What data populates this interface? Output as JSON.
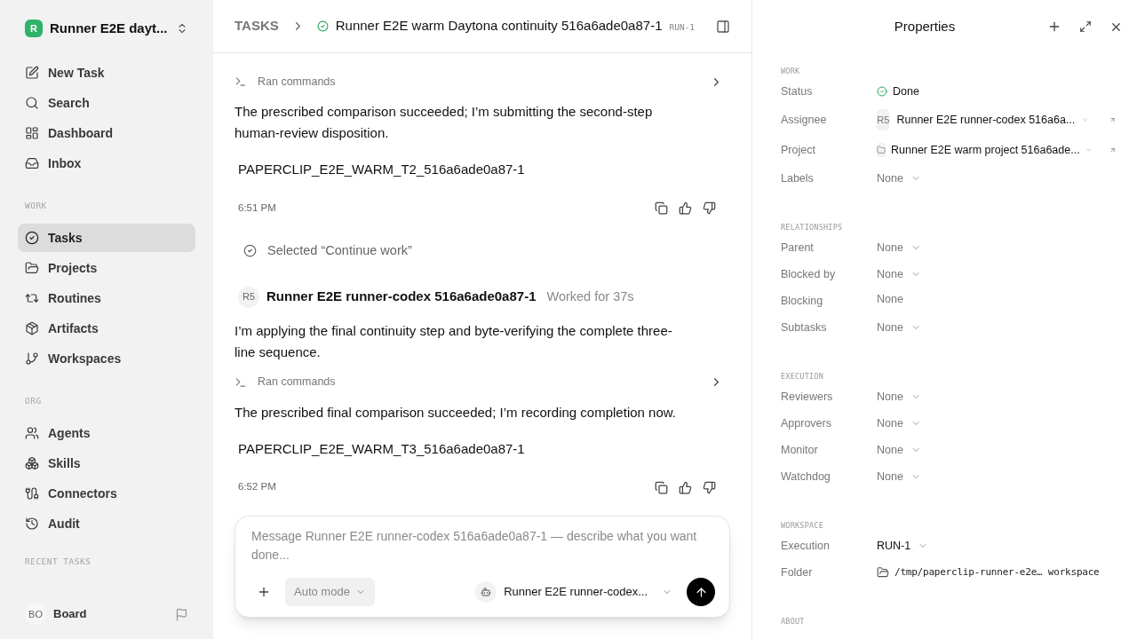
{
  "sidebar": {
    "workspace": {
      "initial": "R",
      "name": "Runner E2E dayt..."
    },
    "top_items": [
      {
        "label": "New Task",
        "selected": false
      },
      {
        "label": "Search",
        "selected": false
      },
      {
        "label": "Dashboard",
        "selected": false
      },
      {
        "label": "Inbox",
        "selected": false
      }
    ],
    "sections": [
      {
        "title": "WORK",
        "items": [
          {
            "label": "Tasks",
            "selected": true
          },
          {
            "label": "Projects",
            "selected": false
          },
          {
            "label": "Routines",
            "selected": false
          },
          {
            "label": "Artifacts",
            "selected": false
          },
          {
            "label": "Workspaces",
            "selected": false
          }
        ]
      },
      {
        "title": "ORG",
        "items": [
          {
            "label": "Agents",
            "selected": false
          },
          {
            "label": "Skills",
            "selected": false
          },
          {
            "label": "Connectors",
            "selected": false
          },
          {
            "label": "Audit",
            "selected": false
          }
        ]
      }
    ],
    "recent_title": "RECENT TASKS",
    "footer": {
      "initials": "BO",
      "label": "Board"
    }
  },
  "header": {
    "crumb": "TASKS",
    "title": "Runner E2E warm Daytona continuity 516a6ade0a87-1",
    "run": "RUN-1"
  },
  "thread": [
    {
      "kind": "commands",
      "label": "Ran commands"
    },
    {
      "kind": "text",
      "text": "The prescribed comparison succeeded; I’m submitting the second-step human-review disposition."
    },
    {
      "kind": "code",
      "text": "PAPERCLIP_E2E_WARM_T2_516a6ade0a87-1"
    },
    {
      "kind": "footer",
      "time": "6:51 PM"
    },
    {
      "kind": "selection",
      "text": "Selected “Continue work”"
    },
    {
      "kind": "author",
      "initials": "R5",
      "name": "Runner E2E runner-codex 516a6ade0a87-1",
      "meta": "Worked for 37s"
    },
    {
      "kind": "text",
      "text": "I’m applying the final continuity step and byte-verifying the complete three-line sequence."
    },
    {
      "kind": "commands",
      "label": "Ran commands"
    },
    {
      "kind": "text",
      "text": "The prescribed final comparison succeeded; I’m recording completion now."
    },
    {
      "kind": "code",
      "text": "PAPERCLIP_E2E_WARM_T3_516a6ade0a87-1"
    },
    {
      "kind": "footer",
      "time": "6:52 PM"
    }
  ],
  "composer": {
    "placeholder": "Message Runner E2E runner-codex 516a6ade0a87-1 — describe what you want done...",
    "mode": "Auto mode",
    "agent": "Runner E2E runner-codex..."
  },
  "properties": {
    "title": "Properties",
    "sections": [
      {
        "title": "WORK",
        "rows": [
          {
            "kind": "status",
            "label": "Status",
            "value": "Done"
          },
          {
            "kind": "agent",
            "label": "Assignee",
            "initials": "R5",
            "value": "Runner E2E runner-codex 516a6a..."
          },
          {
            "kind": "project",
            "label": "Project",
            "value": "Runner E2E warm project 516a6ade..."
          },
          {
            "kind": "select",
            "label": "Labels",
            "value": "None"
          }
        ]
      },
      {
        "title": "RELATIONSHIPS",
        "rows": [
          {
            "kind": "select",
            "label": "Parent",
            "value": "None"
          },
          {
            "kind": "select",
            "label": "Blocked by",
            "value": "None"
          },
          {
            "kind": "plain",
            "label": "Blocking",
            "value": "None"
          },
          {
            "kind": "select",
            "label": "Subtasks",
            "value": "None"
          }
        ]
      },
      {
        "title": "EXECUTION",
        "rows": [
          {
            "kind": "select",
            "label": "Reviewers",
            "value": "None"
          },
          {
            "kind": "select",
            "label": "Approvers",
            "value": "None"
          },
          {
            "kind": "select",
            "label": "Monitor",
            "value": "None"
          },
          {
            "kind": "select",
            "label": "Watchdog",
            "value": "None"
          }
        ]
      },
      {
        "title": "WORKSPACE",
        "rows": [
          {
            "kind": "run",
            "label": "Execution",
            "value": "RUN-1"
          },
          {
            "kind": "path",
            "label": "Folder",
            "value": "/tmp/paperclip-runner-e2e… workspace"
          }
        ]
      },
      {
        "title": "ABOUT"
      }
    ]
  }
}
